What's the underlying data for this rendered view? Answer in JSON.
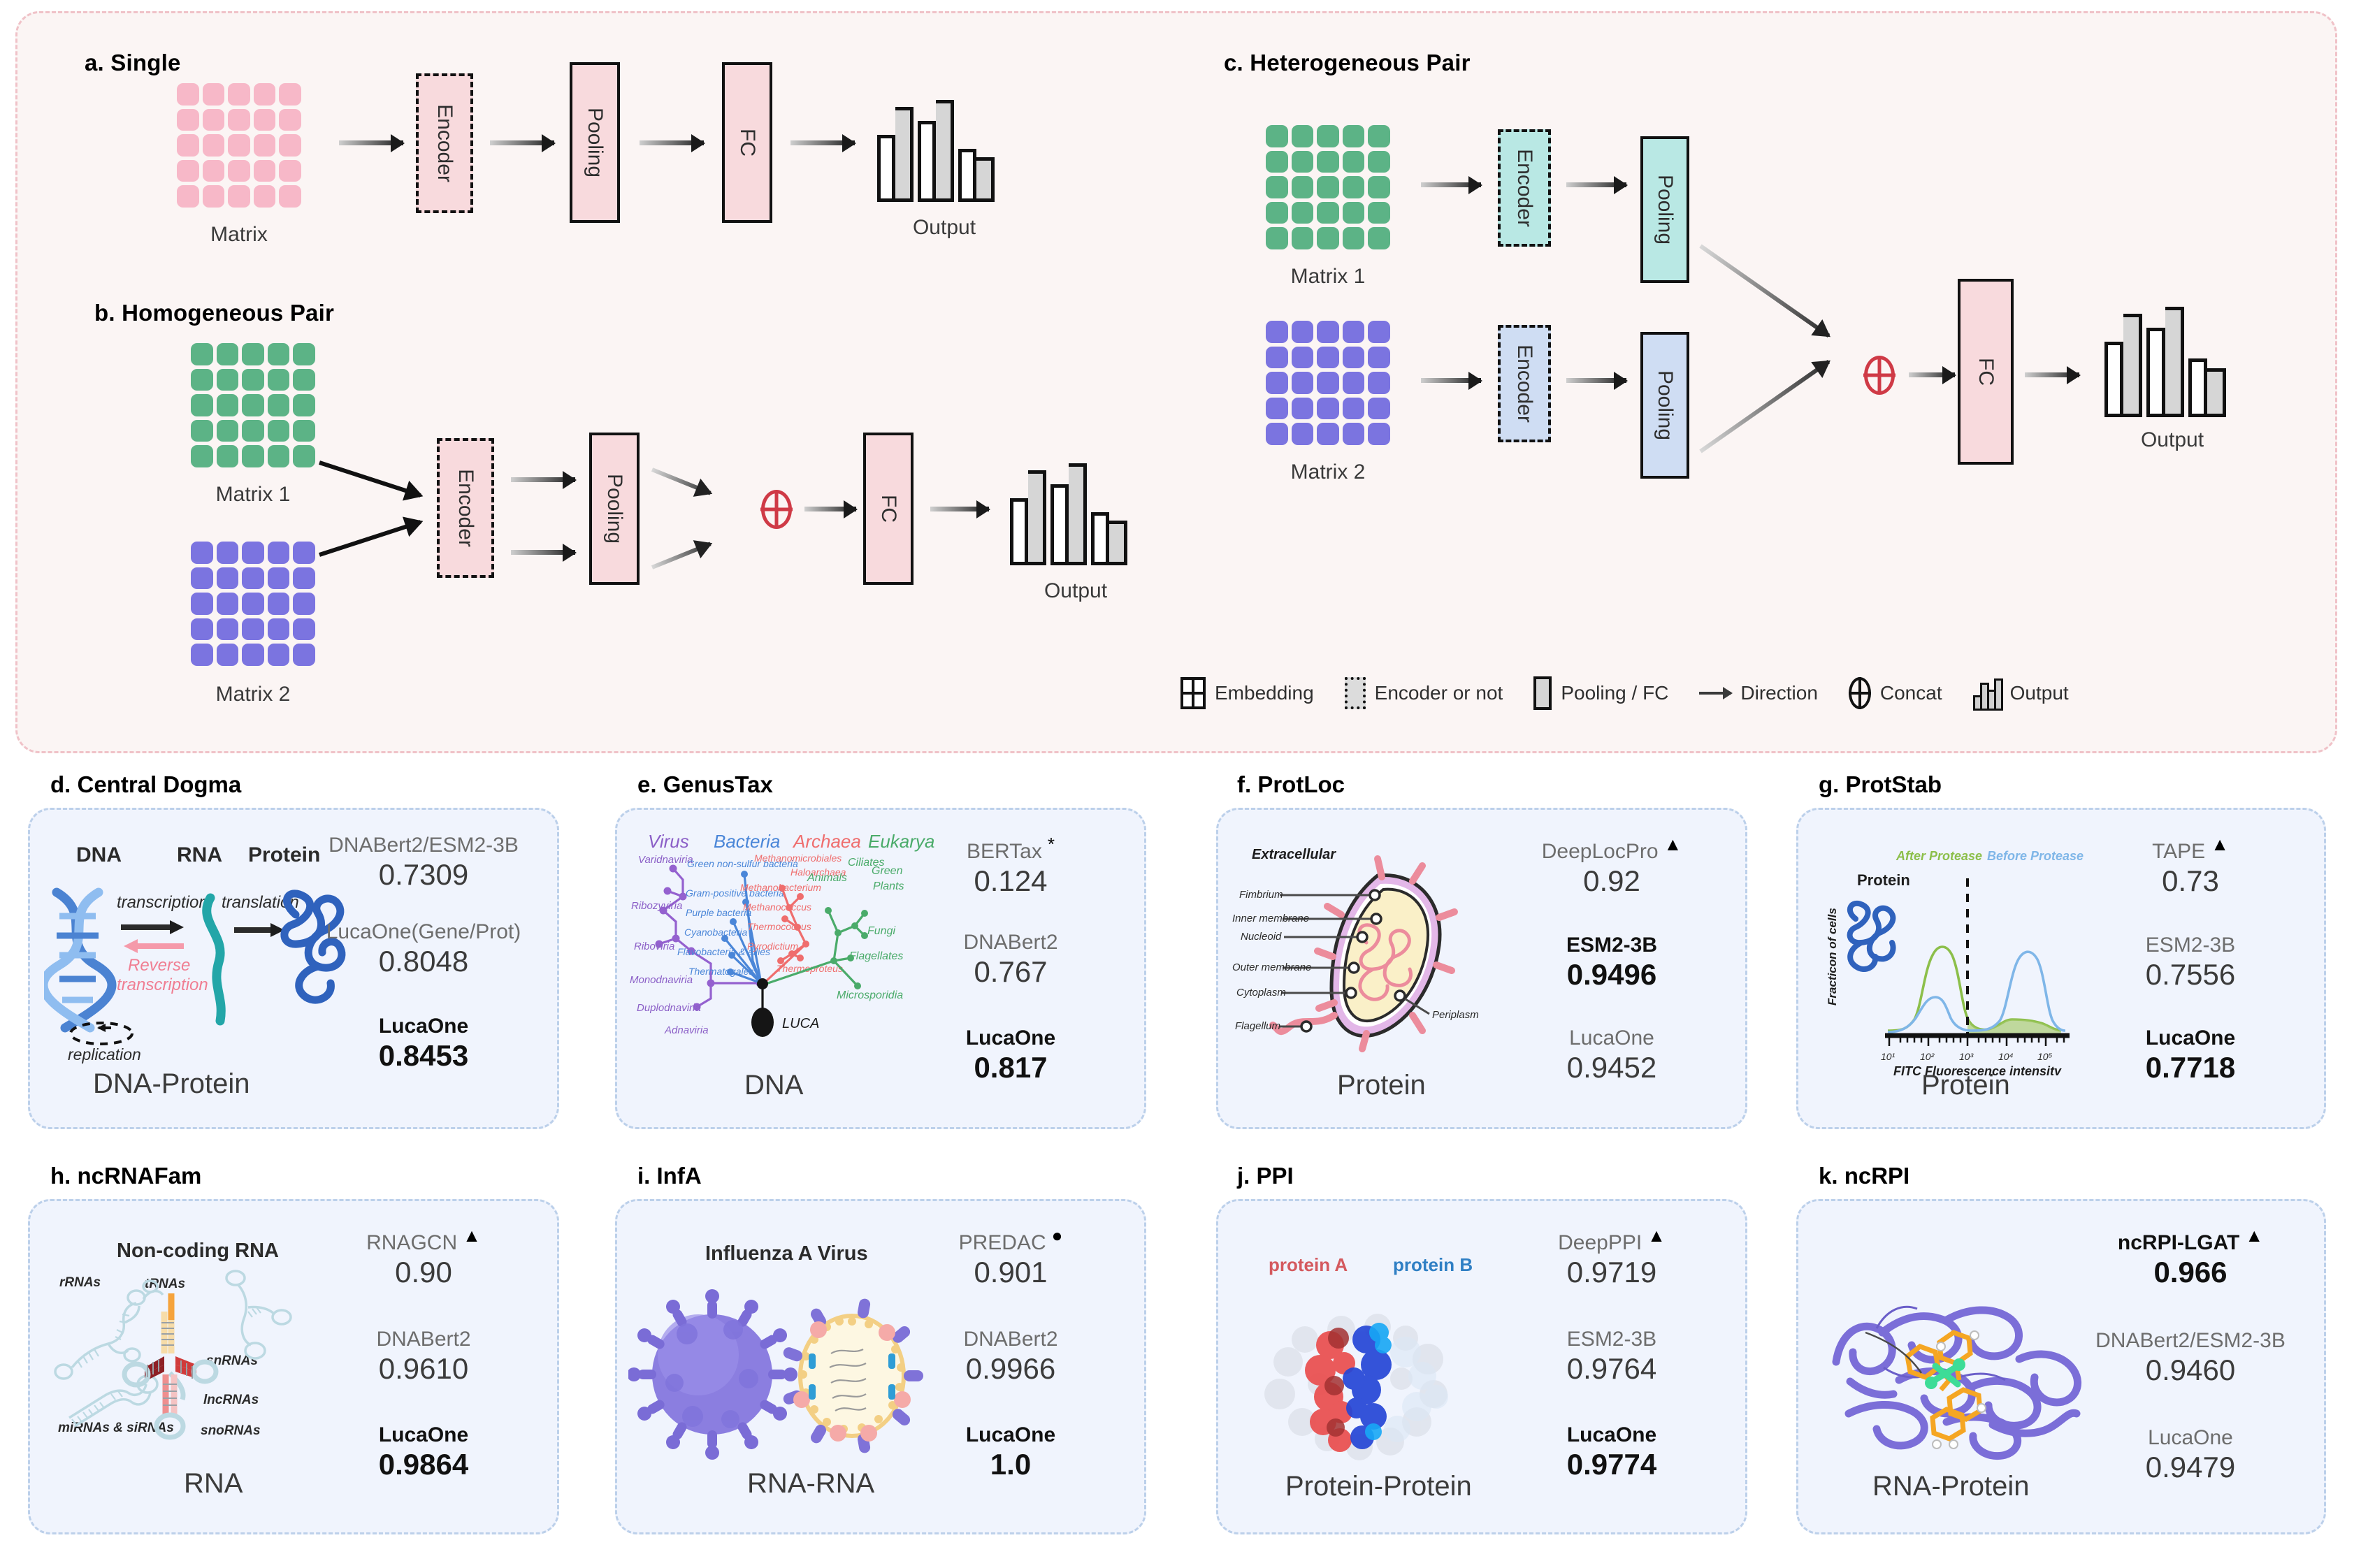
{
  "architecture": {
    "panels": {
      "a": {
        "title": "a. Single",
        "matrix_label": "Matrix",
        "encoder": "Encoder",
        "pooling": "Pooling",
        "fc": "FC",
        "output": "Output"
      },
      "b": {
        "title": "b. Homogeneous Pair",
        "matrix1_label": "Matrix 1",
        "matrix2_label": "Matrix 2",
        "encoder": "Encoder",
        "pooling": "Pooling",
        "fc": "FC",
        "output": "Output"
      },
      "c": {
        "title": "c. Heterogeneous Pair",
        "matrix1_label": "Matrix 1",
        "matrix2_label": "Matrix 2",
        "encoder1": "Encoder",
        "encoder2": "Encoder",
        "pooling1": "Pooling",
        "pooling2": "Pooling",
        "fc": "FC",
        "output": "Output"
      }
    },
    "legend": [
      {
        "icon": "embedding-icon",
        "label": "Embedding"
      },
      {
        "icon": "encoder-dashed-icon",
        "label": "Encoder or not"
      },
      {
        "icon": "pooling-fc-icon",
        "label": "Pooling / FC"
      },
      {
        "icon": "arrow-right-icon",
        "label": "Direction"
      },
      {
        "icon": "concat-plus-icon",
        "label": "Concat"
      },
      {
        "icon": "output-bars-icon",
        "label": "Output"
      }
    ],
    "colors": {
      "panel_bg": "#fbf5f4",
      "panel_border": "#f0c2c8",
      "pink_block": "#f8dadd",
      "teal_block": "#b9e8e4",
      "blue_block": "#cfddf3",
      "matrix_pink": "#f7b8c8",
      "matrix_green": "#5cb386",
      "matrix_purple": "#7b74e0",
      "concat_red": "#cf3a46"
    }
  },
  "tasks": [
    {
      "id": "d",
      "title": "d. Central Dogma",
      "modality": "DNA-Protein",
      "graphic": {
        "type": "central-dogma",
        "stage_labels": [
          "DNA",
          "RNA",
          "Protein"
        ],
        "process_labels": [
          "transcription",
          "translation",
          "Reverse transcription",
          "replication"
        ]
      },
      "metrics": [
        {
          "name": "DNABert2/ESM2-3B",
          "value": "0.7309",
          "best": false,
          "marker": ""
        },
        {
          "name": "LucaOne(Gene/Prot)",
          "value": "0.8048",
          "best": false,
          "marker": ""
        },
        {
          "name": "LucaOne",
          "value": "0.8453",
          "best": true,
          "marker": ""
        }
      ]
    },
    {
      "id": "e",
      "title": "e. GenusTax",
      "modality": "DNA",
      "graphic": {
        "type": "phylogenetic-tree",
        "domain_labels": [
          "Virus",
          "Bacteria",
          "Archaea",
          "Eukarya"
        ],
        "root_label": "LUCA",
        "virus_taxa": [
          "Varidnaviria",
          "Ribozyviria",
          "Riboviria",
          "Monodnaviria",
          "Duplodnaviria",
          "Adnaviria"
        ],
        "bacteria_taxa": [
          "Green non-sulfur bacteria",
          "Gram-positive bacteria",
          "Purple bacteria",
          "Cyanobacteria",
          "Flavobacteria & allies",
          "Thermatogales"
        ],
        "archaea_taxa": [
          "Methanomicrobiales",
          "Haloarchaea",
          "Methanobacterium",
          "Methanococcus",
          "Thermococcus",
          "Pyrodictium",
          "Thermoproteus"
        ],
        "eukarya_taxa": [
          "Ciliates",
          "Green Plants",
          "Animals",
          "Fungi",
          "Flagellates",
          "Microsporidia"
        ]
      },
      "metrics": [
        {
          "name": "BERTax",
          "value": "0.124",
          "best": false,
          "marker": "*"
        },
        {
          "name": "DNABert2",
          "value": "0.767",
          "best": false,
          "marker": ""
        },
        {
          "name": "LucaOne",
          "value": "0.817",
          "best": true,
          "marker": ""
        }
      ]
    },
    {
      "id": "f",
      "title": "f. ProtLoc",
      "modality": "Protein",
      "graphic": {
        "type": "bacterial-cell",
        "heading": "Extracellular",
        "parts": [
          "Fimbrium",
          "Inner membrane",
          "Nucleoid",
          "Outer membrane",
          "Cytoplasm",
          "Flagellum",
          "Periplasm"
        ]
      },
      "metrics": [
        {
          "name": "DeepLocPro",
          "value": "0.92",
          "best": false,
          "marker": "▲"
        },
        {
          "name": "ESM2-3B",
          "value": "0.9496",
          "best": true,
          "marker": ""
        },
        {
          "name": "LucaOne",
          "value": "0.9452",
          "best": false,
          "marker": ""
        }
      ]
    },
    {
      "id": "g",
      "title": "g. ProtStab",
      "modality": "Protein",
      "graphic": {
        "type": "flow-cytometry",
        "curve_labels": [
          "After Protease",
          "Before Protease"
        ],
        "protein_label": "Protein",
        "ylabel": "Fracticon of cells",
        "xlabel": "FITC Fluorescence intensity",
        "xticks": [
          "10¹",
          "10²",
          "10³",
          "10⁴",
          "10⁵"
        ]
      },
      "metrics": [
        {
          "name": "TAPE",
          "value": "0.73",
          "best": false,
          "marker": "▲"
        },
        {
          "name": "ESM2-3B",
          "value": "0.7556",
          "best": false,
          "marker": ""
        },
        {
          "name": "LucaOne",
          "value": "0.7718",
          "best": true,
          "marker": ""
        }
      ]
    },
    {
      "id": "h",
      "title": "h. ncRNAFam",
      "modality": "RNA",
      "graphic": {
        "type": "ncrna-families",
        "heading": "Non-coding RNA",
        "families": [
          "rRNAs",
          "tRNAs",
          "snRNAs",
          "lncRNAs",
          "miRNAs & siRNAs",
          "snoRNAs"
        ]
      },
      "metrics": [
        {
          "name": "RNAGCN",
          "value": "0.90",
          "best": false,
          "marker": "▲"
        },
        {
          "name": "DNABert2",
          "value": "0.9610",
          "best": false,
          "marker": ""
        },
        {
          "name": "LucaOne",
          "value": "0.9864",
          "best": true,
          "marker": ""
        }
      ]
    },
    {
      "id": "i",
      "title": "i. InfA",
      "modality": "RNA-RNA",
      "graphic": {
        "type": "influenza-virus",
        "heading": "Influenza A Virus"
      },
      "metrics": [
        {
          "name": "PREDAC",
          "value": "0.901",
          "best": false,
          "marker": "●"
        },
        {
          "name": "DNABert2",
          "value": "0.9966",
          "best": false,
          "marker": ""
        },
        {
          "name": "LucaOne",
          "value": "1.0",
          "best": true,
          "marker": ""
        }
      ]
    },
    {
      "id": "j",
      "title": "j. PPI",
      "modality": "Protein-Protein",
      "graphic": {
        "type": "protein-complex",
        "labels": [
          "protein A",
          "protein B"
        ]
      },
      "metrics": [
        {
          "name": "DeepPPI",
          "value": "0.9719",
          "best": false,
          "marker": "▲"
        },
        {
          "name": "ESM2-3B",
          "value": "0.9764",
          "best": false,
          "marker": ""
        },
        {
          "name": "LucaOne",
          "value": "0.9774",
          "best": true,
          "marker": ""
        }
      ]
    },
    {
      "id": "k",
      "title": "k. ncRPI",
      "modality": "RNA-Protein",
      "graphic": {
        "type": "rna-protein-ribbon"
      },
      "metrics": [
        {
          "name": "ncRPI-LGAT",
          "value": "0.966",
          "best": true,
          "marker": "▲"
        },
        {
          "name": "DNABert2/ESM2-3B",
          "value": "0.9460",
          "best": false,
          "marker": ""
        },
        {
          "name": "LucaOne",
          "value": "0.9479",
          "best": false,
          "marker": ""
        }
      ]
    }
  ]
}
